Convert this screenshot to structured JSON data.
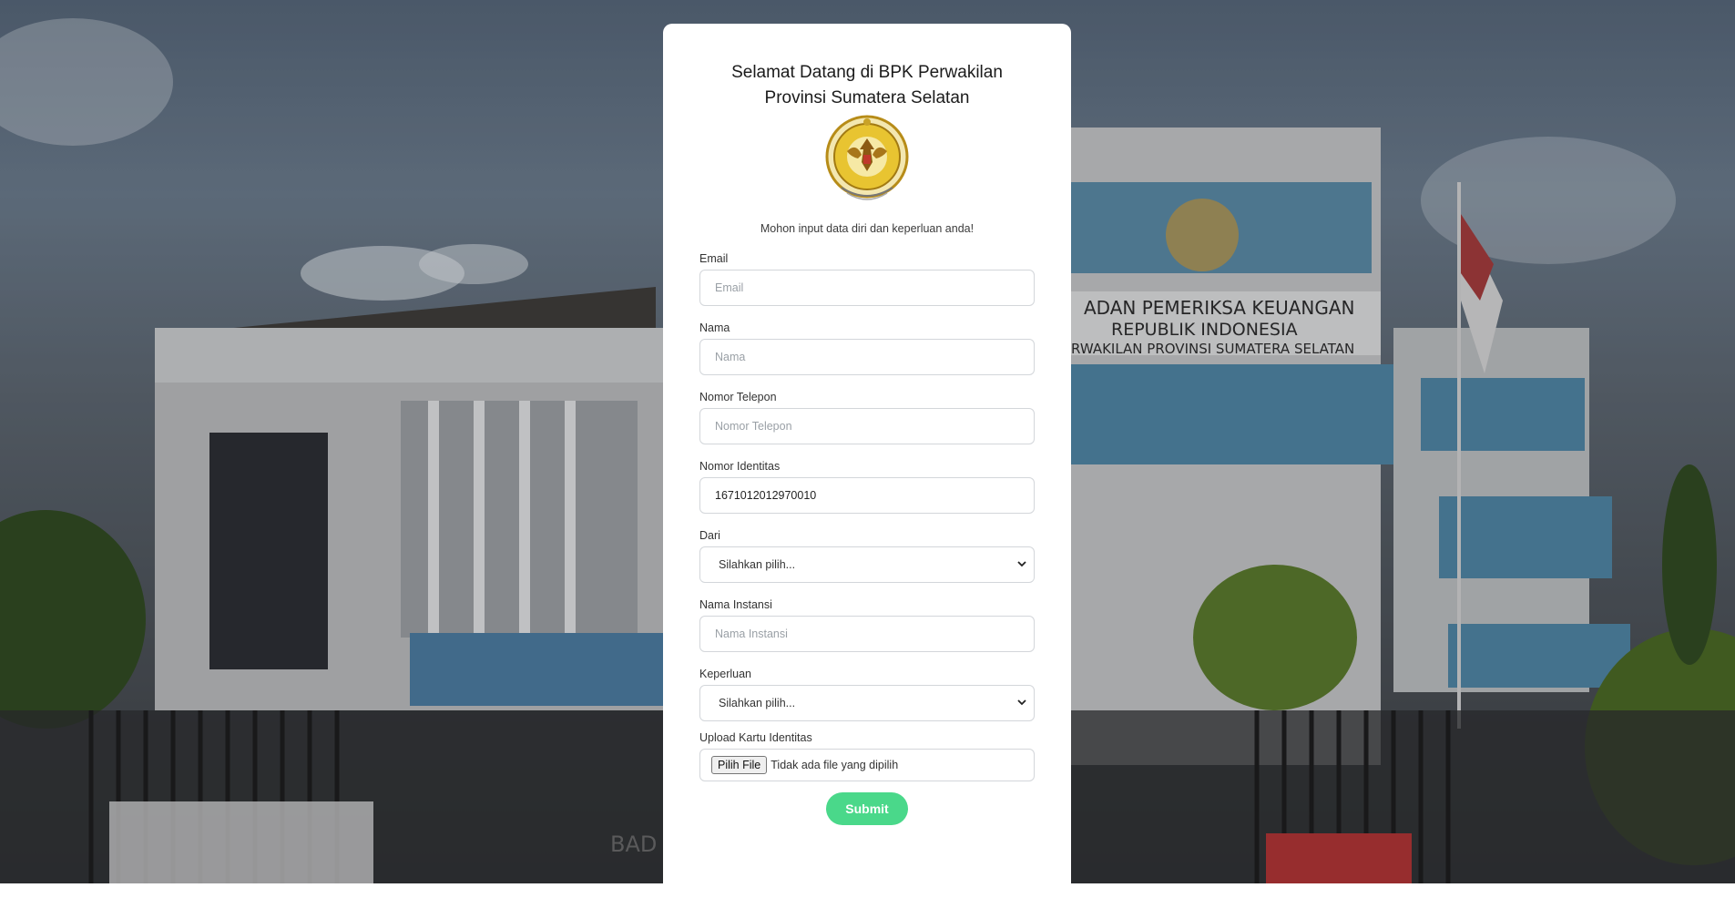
{
  "header": {
    "title": "Selamat Datang di BPK Perwakilan Provinsi Sumatera Selatan",
    "subtitle": "Mohon input data diri dan keperluan anda!"
  },
  "form": {
    "email": {
      "label": "Email",
      "placeholder": "Email",
      "value": ""
    },
    "nama": {
      "label": "Nama",
      "placeholder": "Nama",
      "value": ""
    },
    "telepon": {
      "label": "Nomor Telepon",
      "placeholder": "Nomor Telepon",
      "value": ""
    },
    "identitas": {
      "label": "Nomor Identitas",
      "placeholder": "",
      "value": "1671012012970010"
    },
    "dari": {
      "label": "Dari",
      "selected": "Silahkan pilih..."
    },
    "instansi": {
      "label": "Nama Instansi",
      "placeholder": "Nama Instansi",
      "value": ""
    },
    "keperluan": {
      "label": "Keperluan",
      "selected": "Silahkan pilih..."
    },
    "upload": {
      "label": "Upload Kartu Identitas",
      "button": "Pilih File",
      "status": "Tidak ada file yang dipilih"
    },
    "submit_label": "Submit"
  },
  "background": {
    "building_sign": [
      "BADAN PEMERIKSA KEUANGAN",
      "REPUBLIK INDONESIA",
      "PERWAKILAN PROVINSI SUMATERA SELATAN"
    ],
    "lower_sign": "BADAN"
  },
  "colors": {
    "submit": "#4ad88a",
    "card": "#ffffff",
    "emblem_gold": "#d4a521"
  },
  "icons": {
    "select_arrow": "chevron-down-icon",
    "logo": "bpk-emblem"
  }
}
